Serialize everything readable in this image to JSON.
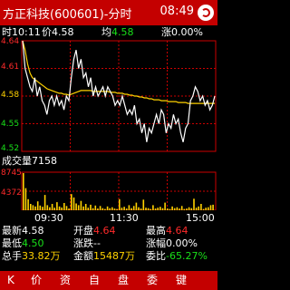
{
  "header": {
    "title": "方正科技(600601)-分时",
    "clock": "08:49"
  },
  "info": {
    "time_label": "时",
    "time_value": "10:11",
    "price_label": "价",
    "price_value": "4.58",
    "avg_label": "均",
    "avg_value": "4.58",
    "change_label": "涨",
    "change_value": "0.00%"
  },
  "chart_data": [
    {
      "type": "line",
      "title": "",
      "ylim": [
        4.52,
        4.64
      ],
      "y_ticks": [
        "4.64",
        "4.61",
        "4.58",
        "4.55",
        "4.52"
      ],
      "x_ticks": [
        "09:30",
        "11:30",
        "15:00"
      ],
      "series": [
        {
          "name": "价",
          "color": "#ffffff",
          "values": [
            4.64,
            4.61,
            4.6,
            4.59,
            4.585,
            4.6,
            4.58,
            4.59,
            4.575,
            4.57,
            4.56,
            4.575,
            4.58,
            4.57,
            4.58,
            4.57,
            4.575,
            4.565,
            4.58,
            4.575,
            4.6,
            4.62,
            4.63,
            4.61,
            4.62,
            4.6,
            4.605,
            4.59,
            4.6,
            4.58,
            4.59,
            4.58,
            4.585,
            4.59,
            4.58,
            4.59,
            4.585,
            4.58,
            4.57,
            4.575,
            4.57,
            4.58,
            4.57,
            4.56,
            4.565,
            4.56,
            4.57,
            4.55,
            4.555,
            4.54,
            4.55,
            4.53,
            4.545,
            4.54,
            4.55,
            4.56,
            4.55,
            4.565,
            4.56,
            4.54,
            4.55,
            4.545,
            4.56,
            4.55,
            4.555,
            4.54,
            4.53,
            4.545,
            4.55,
            4.575,
            4.58,
            4.59,
            4.585,
            4.575,
            4.58,
            4.57,
            4.575,
            4.565,
            4.57,
            4.58
          ]
        },
        {
          "name": "均",
          "color": "#ffd200",
          "values": [
            4.64,
            4.63,
            4.615,
            4.605,
            4.6,
            4.598,
            4.596,
            4.594,
            4.592,
            4.59,
            4.588,
            4.587,
            4.586,
            4.585,
            4.584,
            4.583,
            4.583,
            4.582,
            4.582,
            4.581,
            4.582,
            4.583,
            4.584,
            4.585,
            4.586,
            4.586,
            4.586,
            4.586,
            4.586,
            4.585,
            4.585,
            4.585,
            4.585,
            4.585,
            4.585,
            4.585,
            4.584,
            4.584,
            4.584,
            4.583,
            4.583,
            4.583,
            4.582,
            4.582,
            4.581,
            4.581,
            4.58,
            4.58,
            4.579,
            4.579,
            4.578,
            4.578,
            4.577,
            4.577,
            4.576,
            4.576,
            4.576,
            4.575,
            4.575,
            4.575,
            4.574,
            4.574,
            4.574,
            4.574,
            4.573,
            4.573,
            4.573,
            4.573,
            4.572,
            4.572,
            4.572,
            4.572,
            4.572,
            4.572,
            4.572,
            4.572,
            4.572,
            4.572,
            4.572,
            4.572
          ]
        }
      ]
    },
    {
      "type": "bar",
      "title": "成交量",
      "title_value": "7158",
      "y_ticks": [
        "8745",
        "4372"
      ],
      "ylim": [
        0,
        8745
      ],
      "series": [
        {
          "name": "成交量",
          "color": "#ffd200",
          "values": [
            8745,
            5200,
            2600,
            1500,
            1200,
            900,
            2100,
            1100,
            800,
            3600,
            1200,
            700,
            1500,
            600,
            1900,
            900,
            650,
            1700,
            1000,
            400,
            3800,
            3000,
            1600,
            1200,
            2200,
            900,
            1500,
            600,
            1300,
            500,
            1100,
            400,
            1000,
            500,
            300,
            900,
            500,
            700,
            400,
            300,
            2600,
            600,
            800,
            400,
            1200,
            500,
            1000,
            1800,
            700,
            400,
            2500,
            600,
            500,
            300,
            1200,
            400,
            600,
            800,
            500,
            1800,
            400,
            300,
            900,
            500,
            700,
            400,
            1000,
            300,
            400,
            700,
            500,
            2700,
            600,
            900,
            1500,
            300,
            600,
            700,
            1200,
            1300
          ]
        }
      ]
    }
  ],
  "stats": {
    "zuixin_label": "最新",
    "zuixin_value": "4.58",
    "kaipan_label": "开盘",
    "kaipan_value": "4.64",
    "zuigao_label": "最高",
    "zuigao_value": "4.64",
    "zuidi_label": "最低",
    "zuidi_value": "4.50",
    "zhangdie_label": "涨跌",
    "zhangdie_value": "--",
    "zhangfu_label": "涨幅",
    "zhangfu_value": "0.00%",
    "zongshou_label": "总手",
    "zongshou_value": "33.82万",
    "jine_label": "金额",
    "jine_value": "15487万",
    "weibi_label": "委比",
    "weibi_value": "-65.27%"
  },
  "toolbar": {
    "items": [
      "K",
      "价",
      "资",
      "自",
      "盘",
      "委",
      "键"
    ]
  },
  "colors": {
    "brand": "#c40000",
    "grid": "#cc0000",
    "up": "#ff2a2a",
    "down": "#19e019",
    "price_line": "#ffffff",
    "avg_line": "#ffd200",
    "volume": "#ffd200"
  }
}
